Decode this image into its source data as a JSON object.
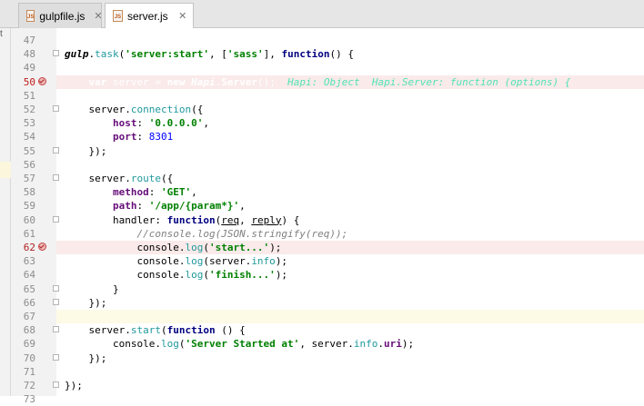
{
  "tabs": [
    {
      "label": "gulpfile.js",
      "icon": "javascript-file-icon",
      "active": false
    },
    {
      "label": "server.js",
      "icon": "javascript-file-icon",
      "active": true
    }
  ],
  "tab_icon_text": "JS",
  "close_glyph": "✕",
  "edge_fragment": "t",
  "colors": {
    "selection": "#3d6fbf",
    "breakpoint_line": "#faeaea",
    "caret_line": "#fdfae6",
    "keyword": "#000080",
    "string": "#008000",
    "property": "#660e7a",
    "method": "#20999d",
    "number": "#0000ff",
    "comment": "#808080",
    "inline_hint": "#4fe3b4"
  },
  "editor": {
    "lines": [
      {
        "n": "47",
        "segs": [
          {
            "t": ""
          }
        ]
      },
      {
        "n": "48",
        "segs": [
          {
            "t": "gulp",
            "c": "g"
          },
          {
            "t": "."
          },
          {
            "t": "task",
            "c": "m"
          },
          {
            "t": "("
          },
          {
            "t": "'server:start'",
            "c": "s"
          },
          {
            "t": ", ["
          },
          {
            "t": "'sass'",
            "c": "s"
          },
          {
            "t": "], "
          },
          {
            "t": "function",
            "c": "k"
          },
          {
            "t": "() {"
          }
        ]
      },
      {
        "n": "49",
        "segs": [
          {
            "t": ""
          }
        ]
      },
      {
        "n": "50",
        "bp": true,
        "sel": true,
        "segs": [
          {
            "t": "    "
          },
          {
            "t": "var",
            "c": "k"
          },
          {
            "t": " server = "
          },
          {
            "t": "new",
            "c": "k"
          },
          {
            "t": " "
          },
          {
            "t": "Hapi",
            "c": "g"
          },
          {
            "t": "."
          },
          {
            "t": "Server",
            "c": "k"
          },
          {
            "t": "();  "
          },
          {
            "t": "Hapi: Object  Hapi.Server: function (options) {",
            "c": "hint"
          }
        ]
      },
      {
        "n": "51",
        "segs": [
          {
            "t": ""
          }
        ]
      },
      {
        "n": "52",
        "segs": [
          {
            "t": "    server."
          },
          {
            "t": "connection",
            "c": "m"
          },
          {
            "t": "({"
          }
        ]
      },
      {
        "n": "53",
        "segs": [
          {
            "t": "        "
          },
          {
            "t": "host",
            "c": "p"
          },
          {
            "t": ": "
          },
          {
            "t": "'0.0.0.0'",
            "c": "s"
          },
          {
            "t": ","
          }
        ]
      },
      {
        "n": "54",
        "segs": [
          {
            "t": "        "
          },
          {
            "t": "port",
            "c": "p"
          },
          {
            "t": ": "
          },
          {
            "t": "8301",
            "c": "n"
          }
        ]
      },
      {
        "n": "55",
        "segs": [
          {
            "t": "    });"
          }
        ]
      },
      {
        "n": "56",
        "segs": [
          {
            "t": ""
          }
        ]
      },
      {
        "n": "57",
        "segs": [
          {
            "t": "    server."
          },
          {
            "t": "route",
            "c": "m"
          },
          {
            "t": "({"
          }
        ]
      },
      {
        "n": "58",
        "segs": [
          {
            "t": "        "
          },
          {
            "t": "method",
            "c": "p"
          },
          {
            "t": ": "
          },
          {
            "t": "'GET'",
            "c": "s"
          },
          {
            "t": ","
          }
        ]
      },
      {
        "n": "59",
        "segs": [
          {
            "t": "        "
          },
          {
            "t": "path",
            "c": "p"
          },
          {
            "t": ": "
          },
          {
            "t": "'/app/{param*}'",
            "c": "s"
          },
          {
            "t": ","
          }
        ]
      },
      {
        "n": "60",
        "segs": [
          {
            "t": "        handler: "
          },
          {
            "t": "function",
            "c": "k"
          },
          {
            "t": "("
          },
          {
            "t": "req",
            "c": "u"
          },
          {
            "t": ", "
          },
          {
            "t": "reply",
            "c": "u"
          },
          {
            "t": ") {"
          }
        ]
      },
      {
        "n": "61",
        "segs": [
          {
            "t": "            "
          },
          {
            "t": "//console.log(JSON.stringify(req));",
            "c": "c"
          }
        ]
      },
      {
        "n": "62",
        "bp": true,
        "segs": [
          {
            "t": "            console."
          },
          {
            "t": "log",
            "c": "m"
          },
          {
            "t": "("
          },
          {
            "t": "'start...'",
            "c": "s"
          },
          {
            "t": ");"
          }
        ]
      },
      {
        "n": "63",
        "segs": [
          {
            "t": "            console."
          },
          {
            "t": "log",
            "c": "m"
          },
          {
            "t": "(server."
          },
          {
            "t": "info",
            "c": "m"
          },
          {
            "t": ");"
          }
        ]
      },
      {
        "n": "64",
        "segs": [
          {
            "t": "            console."
          },
          {
            "t": "log",
            "c": "m"
          },
          {
            "t": "("
          },
          {
            "t": "'finish...'",
            "c": "s"
          },
          {
            "t": ");"
          }
        ]
      },
      {
        "n": "65",
        "segs": [
          {
            "t": "        }"
          }
        ]
      },
      {
        "n": "66",
        "segs": [
          {
            "t": "    });"
          }
        ]
      },
      {
        "n": "67",
        "cur": true,
        "segs": [
          {
            "t": ""
          }
        ]
      },
      {
        "n": "68",
        "segs": [
          {
            "t": "    server."
          },
          {
            "t": "start",
            "c": "m"
          },
          {
            "t": "("
          },
          {
            "t": "function",
            "c": "k"
          },
          {
            "t": " () {"
          }
        ]
      },
      {
        "n": "69",
        "segs": [
          {
            "t": "        console."
          },
          {
            "t": "log",
            "c": "m"
          },
          {
            "t": "("
          },
          {
            "t": "'Server Started at'",
            "c": "s"
          },
          {
            "t": ", server."
          },
          {
            "t": "info",
            "c": "m"
          },
          {
            "t": "."
          },
          {
            "t": "uri",
            "c": "p"
          },
          {
            "t": ");"
          }
        ]
      },
      {
        "n": "70",
        "segs": [
          {
            "t": "    });"
          }
        ]
      },
      {
        "n": "71",
        "segs": [
          {
            "t": ""
          }
        ]
      },
      {
        "n": "72",
        "segs": [
          {
            "t": "});"
          }
        ]
      },
      {
        "n": "73",
        "segs": [
          {
            "t": ""
          }
        ]
      }
    ]
  }
}
